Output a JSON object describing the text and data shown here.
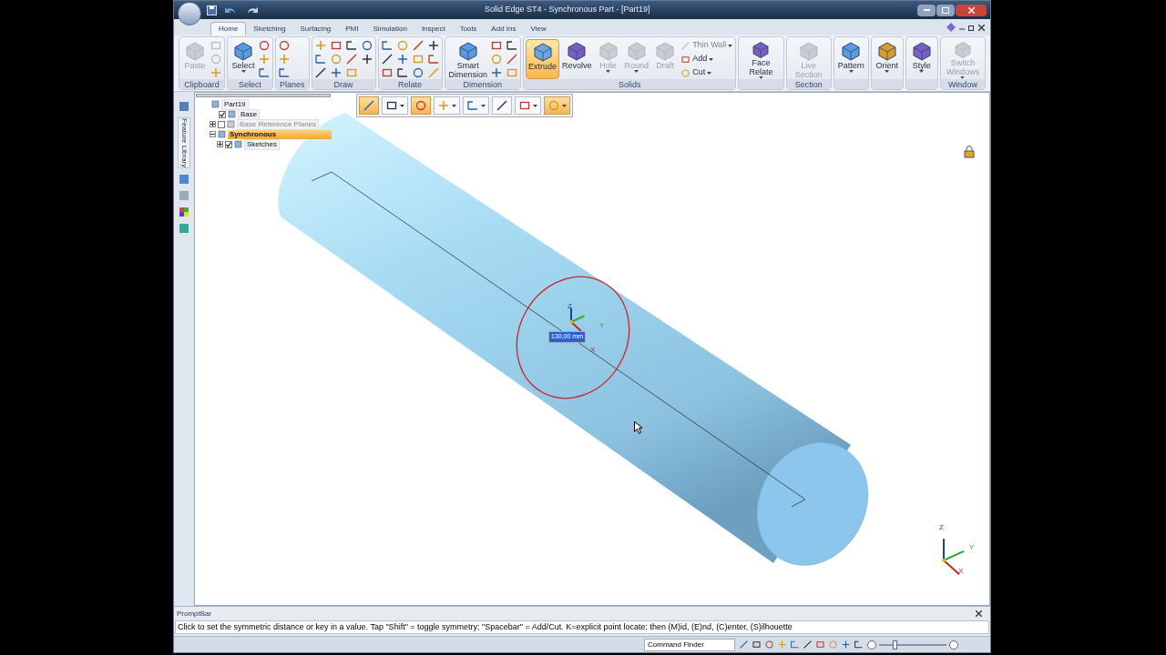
{
  "window": {
    "title": "Solid Edge ST4 - Synchronous Part - [Part19]"
  },
  "ribbon_tabs": [
    {
      "label": "Home",
      "selected": true
    },
    {
      "label": "Sketching",
      "selected": false
    },
    {
      "label": "Surfacing",
      "selected": false
    },
    {
      "label": "PMI",
      "selected": false
    },
    {
      "label": "Simulation",
      "selected": false
    },
    {
      "label": "Inspect",
      "selected": false
    },
    {
      "label": "Tools",
      "selected": false
    },
    {
      "label": "Add Ins",
      "selected": false
    },
    {
      "label": "View",
      "selected": false
    }
  ],
  "ribbon_groups": [
    {
      "label": "Clipboard",
      "items": [
        {
          "kind": "large",
          "label": "Paste",
          "disabled": true,
          "active": false,
          "dropdown": false
        },
        {
          "kind": "icon",
          "disabled": true
        },
        {
          "kind": "icon",
          "disabled": true
        },
        {
          "kind": "icon",
          "disabled": false
        }
      ]
    },
    {
      "label": "Select",
      "items": [
        {
          "kind": "large",
          "label": "Select",
          "disabled": false,
          "active": false,
          "dropdown": true
        },
        {
          "kind": "icon",
          "disabled": false
        },
        {
          "kind": "icon",
          "disabled": false
        },
        {
          "kind": "icon",
          "disabled": false
        }
      ]
    },
    {
      "label": "Planes",
      "items": [
        {
          "kind": "icon",
          "disabled": false
        },
        {
          "kind": "icon",
          "disabled": false
        },
        {
          "kind": "icon",
          "disabled": false
        }
      ]
    },
    {
      "label": "Draw",
      "items": [
        {
          "kind": "icon",
          "disabled": false
        },
        {
          "kind": "icon",
          "disabled": false
        },
        {
          "kind": "icon",
          "disabled": false
        },
        {
          "kind": "icon",
          "disabled": false
        },
        {
          "kind": "icon",
          "disabled": false
        },
        {
          "kind": "icon",
          "disabled": false
        },
        {
          "kind": "icon",
          "disabled": false
        },
        {
          "kind": "icon",
          "disabled": false
        },
        {
          "kind": "icon",
          "disabled": false
        },
        {
          "kind": "icon",
          "disabled": false
        },
        {
          "kind": "icon",
          "disabled": false
        }
      ]
    },
    {
      "label": "Relate",
      "items": [
        {
          "kind": "icon",
          "disabled": false
        },
        {
          "kind": "icon",
          "disabled": false
        },
        {
          "kind": "icon",
          "disabled": false
        },
        {
          "kind": "icon",
          "disabled": false
        },
        {
          "kind": "icon",
          "disabled": false
        },
        {
          "kind": "icon",
          "disabled": false
        },
        {
          "kind": "icon",
          "disabled": false
        },
        {
          "kind": "icon",
          "disabled": false
        },
        {
          "kind": "icon",
          "disabled": false
        },
        {
          "kind": "icon",
          "disabled": false
        },
        {
          "kind": "icon",
          "disabled": false
        },
        {
          "kind": "icon",
          "disabled": false
        }
      ]
    },
    {
      "label": "Dimension",
      "items": [
        {
          "kind": "large",
          "label": "Smart Dimension",
          "disabled": false,
          "active": false,
          "dropdown": false
        },
        {
          "kind": "icon",
          "disabled": false
        },
        {
          "kind": "icon",
          "disabled": false
        },
        {
          "kind": "icon",
          "disabled": false
        },
        {
          "kind": "icon",
          "disabled": false
        },
        {
          "kind": "icon",
          "disabled": false
        },
        {
          "kind": "icon",
          "disabled": false
        }
      ]
    },
    {
      "label": "Solids",
      "items": [
        {
          "kind": "large",
          "label": "Extrude",
          "disabled": false,
          "active": true,
          "dropdown": false
        },
        {
          "kind": "large",
          "label": "Revolve",
          "disabled": false,
          "active": false,
          "dropdown": false
        },
        {
          "kind": "large",
          "label": "Hole",
          "disabled": true,
          "active": false,
          "dropdown": true
        },
        {
          "kind": "large",
          "label": "Round",
          "disabled": true,
          "active": false,
          "dropdown": true
        },
        {
          "kind": "large",
          "label": "Draft",
          "disabled": true,
          "active": false,
          "dropdown": false
        },
        {
          "kind": "small",
          "label": "Thin Wall",
          "disabled": true
        },
        {
          "kind": "small",
          "label": "Add",
          "disabled": false
        },
        {
          "kind": "small",
          "label": "Cut",
          "disabled": false
        }
      ]
    },
    {
      "items": [
        {
          "kind": "large",
          "label": "Face Relate",
          "disabled": false,
          "active": false,
          "dropdown": true
        }
      ]
    },
    {
      "label": "Section",
      "items": [
        {
          "kind": "large",
          "label": "Live Section",
          "disabled": true,
          "active": false,
          "dropdown": false
        }
      ]
    },
    {
      "items": [
        {
          "kind": "large",
          "label": "Pattern",
          "disabled": false,
          "active": false,
          "dropdown": true
        }
      ]
    },
    {
      "items": [
        {
          "kind": "large",
          "label": "Orient",
          "disabled": false,
          "active": false,
          "dropdown": true
        }
      ]
    },
    {
      "items": [
        {
          "kind": "large",
          "label": "Style",
          "disabled": false,
          "active": false,
          "dropdown": true
        }
      ]
    },
    {
      "label": "Window",
      "items": [
        {
          "kind": "large",
          "label": "Switch Windows",
          "disabled": true,
          "active": false,
          "dropdown": true
        }
      ]
    }
  ],
  "side_tab": {
    "label": "Feature Library"
  },
  "tree": {
    "label": "Part19",
    "children": [
      {
        "label": "Base",
        "checked": true,
        "selected": false,
        "dimmed": false
      },
      {
        "label": "Base Reference Planes",
        "checked": false,
        "expanded": false,
        "selected": false,
        "dimmed": true
      },
      {
        "label": "Synchronous",
        "expanded": true,
        "selected": true,
        "dimmed": false,
        "children": [
          {
            "label": "Sketches",
            "checked": true,
            "expanded": false,
            "selected": false,
            "dimmed": false
          }
        ]
      }
    ]
  },
  "command_bar": [
    {
      "active": true,
      "dropdown": false
    },
    {
      "active": false,
      "dropdown": true
    },
    {
      "active": true,
      "dropdown": false
    },
    {
      "active": false,
      "dropdown": true
    },
    {
      "active": false,
      "dropdown": true
    },
    {
      "active": false,
      "dropdown": false
    },
    {
      "active": false,
      "dropdown": true
    },
    {
      "active": true,
      "dropdown": true
    }
  ],
  "viewport": {
    "dimension": "130,00 mm",
    "triad": {
      "z": "Z",
      "y": "Y",
      "x": "X"
    },
    "view_triad": {
      "z": "Z",
      "y": "Y",
      "x": "X"
    }
  },
  "prompt_bar": {
    "title": "PromptBar",
    "text": "Click to set the symmetric distance or key in a value.  Tap \"Shift\" = toggle symmetry; \"Spacebar\" = Add/Cut.  K=explicit point locate; then (M)id, (E)nd, (C)enter, (S)ilhouette"
  },
  "status_bar": {
    "command_finder": "Command Finder",
    "zoom": {
      "level": 0.2
    }
  }
}
